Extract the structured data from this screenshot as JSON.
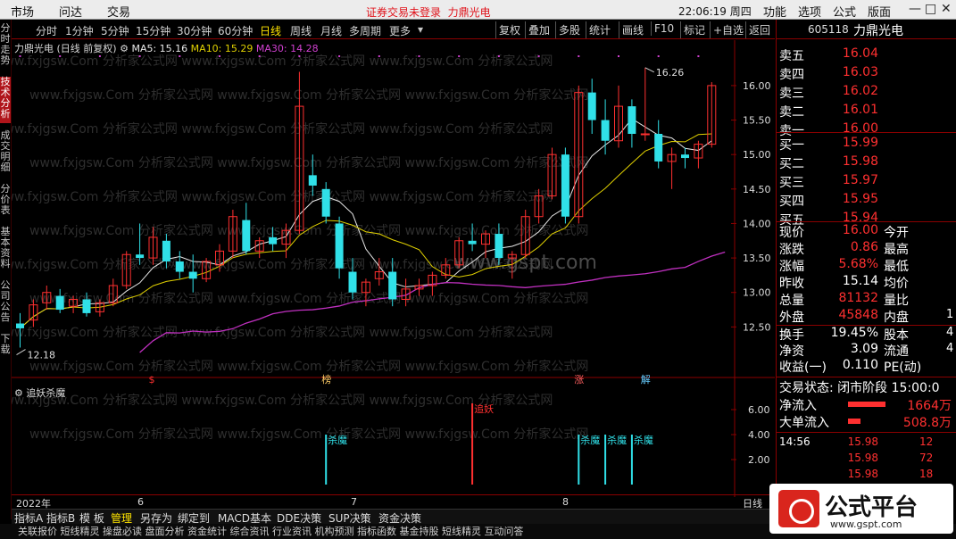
{
  "menubar": {
    "market": "市场",
    "ask": "问达",
    "trade": "交易",
    "login": "证券交易未登录",
    "stock_link": "力鼎光电",
    "clock": "22:06:19 周四",
    "tabs": [
      "功能",
      "选项",
      "公式",
      "版面"
    ],
    "min": "—",
    "max": "□",
    "close": "✕"
  },
  "left_tabs": [
    "分时走势",
    "技术分析",
    "成交明细",
    "分价表",
    "基本资料",
    "公司公告",
    "下载"
  ],
  "period_bar": [
    "分时",
    "1分钟",
    "5分钟",
    "15分钟",
    "30分钟",
    "60分钟",
    "日线",
    "周线",
    "月线",
    "多周期",
    "更多"
  ],
  "period_active": "日线",
  "tools": [
    "复权",
    "叠加",
    "多股",
    "统计",
    "画线",
    "F10",
    "标记",
    "+自选",
    "返回"
  ],
  "title": {
    "stock": "力鼎光电 (日线 前复权)",
    "ma5": "MA5: 15.16",
    "ma10": "MA10: 15.29",
    "ma30": "MA30: 14.28"
  },
  "price_axis": [
    "16.00",
    "15.50",
    "15.00",
    "14.50",
    "14.00",
    "13.50",
    "13.00",
    "12.50"
  ],
  "high_label": "16.26",
  "low_label": "12.18",
  "markers": [
    "$",
    "榜",
    "涨",
    "解"
  ],
  "sub": {
    "name": "追妖杀魔",
    "labels": [
      "杀魔",
      "追妖",
      "杀魔",
      "杀魔",
      "杀魔"
    ],
    "axis": [
      "6.00",
      "4.00",
      "2.00"
    ]
  },
  "date_axis": [
    "2022年",
    "6",
    "7",
    "8"
  ],
  "period_label": "日线",
  "bottom_tabs": [
    "指标A",
    "指标B",
    "模 板",
    "管理",
    "另存为",
    "绑定到",
    "MACD基本",
    "DDE决策",
    "SUP决策",
    "资金决策"
  ],
  "bottom_active": "管理",
  "footer": "关联报价  短线精灵  操盘必读  盘面分析  资金统计  综合资讯  行业资讯  机构预测  指标函数  基金持股  短线精灵  互动问答",
  "watermark": "www.gspt.com",
  "right": {
    "code": "605118",
    "name": "力鼎光电",
    "sell": [
      [
        "卖五",
        "16.04"
      ],
      [
        "卖四",
        "16.03"
      ],
      [
        "卖三",
        "16.02"
      ],
      [
        "卖二",
        "16.01"
      ],
      [
        "卖一",
        "16.00"
      ]
    ],
    "buy": [
      [
        "买一",
        "15.99"
      ],
      [
        "买二",
        "15.98"
      ],
      [
        "买三",
        "15.97"
      ],
      [
        "买四",
        "15.95"
      ],
      [
        "买五",
        "15.94"
      ]
    ],
    "info": [
      [
        "现价",
        "16.00",
        "今开",
        ""
      ],
      [
        "涨跌",
        "0.86",
        "最高",
        ""
      ],
      [
        "涨幅",
        "5.68%",
        "最低",
        ""
      ],
      [
        "昨收",
        "15.14",
        "均价",
        ""
      ],
      [
        "总量",
        "81132",
        "量比",
        ""
      ],
      [
        "外盘",
        "45848",
        "内盘",
        "1"
      ]
    ],
    "info2": [
      [
        "换手",
        "19.45%",
        "股本",
        "4"
      ],
      [
        "净资",
        "3.09",
        "流通",
        "4"
      ],
      [
        "收益(一)",
        "0.110",
        "PE(动)",
        ""
      ]
    ],
    "status": "交易状态: 闭市阶段 15:00:0",
    "flow": [
      [
        "净流入",
        "1664万"
      ],
      [
        "大单流入",
        "508.8万"
      ]
    ],
    "ticks": [
      [
        "14:56",
        "15.98",
        "12"
      ],
      [
        "",
        "15.98",
        "72"
      ],
      [
        "",
        "15.98",
        "18"
      ]
    ]
  },
  "logo": {
    "text": "公式平台",
    "url": "www.gspt.com"
  },
  "chart_data": {
    "type": "candlestick",
    "candles": [
      [
        12.55,
        12.7,
        12.2,
        12.48
      ],
      [
        12.6,
        12.9,
        12.5,
        12.82
      ],
      [
        12.85,
        13.1,
        12.75,
        13.0
      ],
      [
        12.95,
        13.05,
        12.7,
        12.75
      ],
      [
        12.8,
        12.95,
        12.7,
        12.9
      ],
      [
        12.9,
        13.0,
        12.65,
        12.7
      ],
      [
        12.72,
        12.9,
        12.65,
        12.85
      ],
      [
        12.85,
        13.2,
        12.8,
        13.1
      ],
      [
        13.1,
        13.6,
        13.05,
        13.55
      ],
      [
        13.55,
        14.0,
        13.4,
        13.5
      ],
      [
        13.5,
        13.95,
        13.4,
        13.8
      ],
      [
        13.75,
        13.85,
        13.35,
        13.45
      ],
      [
        13.45,
        13.6,
        13.2,
        13.3
      ],
      [
        13.3,
        13.55,
        13.0,
        13.2
      ],
      [
        13.2,
        13.5,
        13.15,
        13.45
      ],
      [
        13.4,
        13.7,
        13.3,
        13.6
      ],
      [
        13.6,
        14.2,
        13.5,
        14.1
      ],
      [
        14.05,
        14.3,
        13.55,
        13.6
      ],
      [
        13.6,
        13.8,
        13.5,
        13.75
      ],
      [
        13.8,
        13.95,
        13.6,
        13.7
      ],
      [
        13.7,
        14.0,
        13.5,
        13.9
      ],
      [
        13.9,
        16.2,
        13.85,
        15.7
      ],
      [
        14.7,
        15.0,
        14.4,
        14.55
      ],
      [
        14.5,
        14.6,
        14.0,
        14.1
      ],
      [
        14.0,
        14.1,
        13.2,
        13.35
      ],
      [
        13.3,
        13.5,
        12.9,
        13.0
      ],
      [
        13.0,
        13.2,
        12.8,
        13.15
      ],
      [
        13.2,
        13.5,
        13.1,
        13.3
      ],
      [
        13.3,
        13.5,
        12.8,
        12.9
      ],
      [
        12.9,
        13.2,
        12.8,
        13.05
      ],
      [
        13.05,
        13.2,
        12.95,
        13.1
      ],
      [
        13.1,
        13.3,
        12.95,
        13.25
      ],
      [
        13.25,
        13.5,
        13.2,
        13.4
      ],
      [
        13.4,
        13.8,
        13.35,
        13.75
      ],
      [
        13.75,
        14.0,
        13.6,
        13.7
      ],
      [
        13.7,
        13.9,
        13.5,
        13.85
      ],
      [
        13.85,
        14.0,
        13.4,
        13.5
      ],
      [
        13.5,
        13.6,
        13.2,
        13.55
      ],
      [
        13.55,
        14.2,
        13.5,
        14.1
      ],
      [
        14.1,
        14.5,
        14.0,
        14.4
      ],
      [
        14.4,
        15.1,
        14.35,
        15.0
      ],
      [
        15.0,
        15.1,
        14.0,
        14.1
      ],
      [
        14.1,
        16.0,
        14.0,
        15.9
      ],
      [
        15.9,
        16.1,
        15.3,
        15.5
      ],
      [
        15.5,
        15.8,
        15.0,
        15.2
      ],
      [
        15.2,
        16.0,
        15.1,
        15.7
      ],
      [
        15.7,
        15.8,
        15.1,
        15.3
      ],
      [
        15.3,
        16.26,
        15.2,
        15.3
      ],
      [
        15.3,
        15.5,
        14.8,
        14.9
      ],
      [
        14.9,
        15.1,
        14.5,
        15.0
      ],
      [
        15.0,
        15.1,
        14.8,
        14.95
      ],
      [
        14.95,
        15.2,
        14.8,
        15.15
      ],
      [
        15.15,
        16.05,
        15.1,
        16.0
      ]
    ],
    "price_min": 12.0,
    "price_max": 16.4
  }
}
